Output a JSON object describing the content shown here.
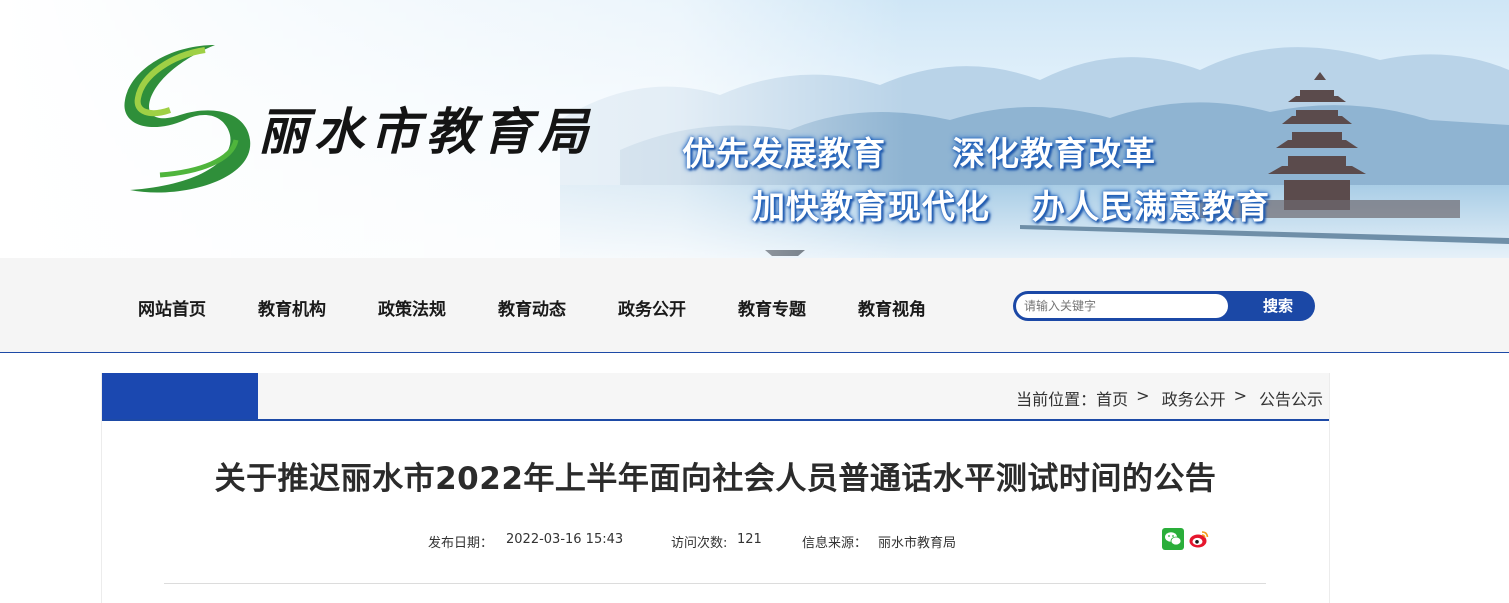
{
  "banner": {
    "site_name": "丽水市教育局",
    "slogans": [
      "优先发展教育",
      "深化教育改革",
      "加快教育现代化",
      "办人民满意教育"
    ]
  },
  "nav": {
    "items": [
      {
        "label": "网站首页"
      },
      {
        "label": "教育机构"
      },
      {
        "label": "政策法规"
      },
      {
        "label": "教育动态"
      },
      {
        "label": "政务公开"
      },
      {
        "label": "教育专题"
      },
      {
        "label": "教育视角"
      }
    ]
  },
  "search": {
    "placeholder": "请输入关键字",
    "button_label": "搜索"
  },
  "breadcrumb": {
    "prefix": "当前位置：",
    "items": [
      {
        "label": "首页"
      },
      {
        "label": "政务公开"
      },
      {
        "label": "公告公示"
      }
    ],
    "separator": ">"
  },
  "article": {
    "title": "关于推迟丽水市2022年上半年面向社会人员普通话水平测试时间的公告",
    "publish_label": "发布日期：",
    "publish_date": "2022-03-16  15:43",
    "visits_label": "访问次数:",
    "visits": "121",
    "source_label": "信息来源：",
    "source": "丽水市教育局"
  },
  "share": {
    "icons": [
      "wechat-icon",
      "weibo-icon"
    ]
  },
  "colors": {
    "nav_blue": "#1b48a6",
    "logo_green": "#3a9a3c",
    "slogan_blue": "#2f74cf"
  }
}
